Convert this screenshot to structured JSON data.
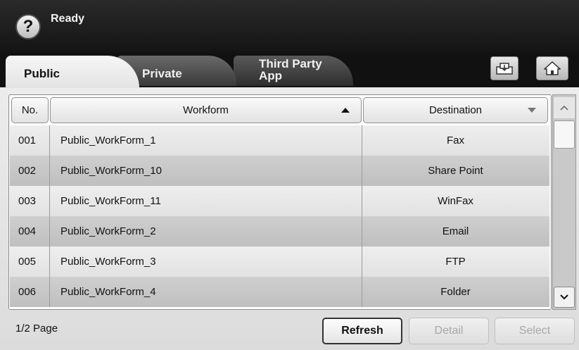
{
  "header": {
    "help_symbol": "?",
    "status": "Ready"
  },
  "tabs": [
    {
      "label": "Public",
      "active": true
    },
    {
      "label": "Private",
      "active": false
    },
    {
      "label": "Third Party App",
      "active": false
    }
  ],
  "toolbar": {
    "left_icon": "tray-icon",
    "right_icon": "home-icon"
  },
  "table": {
    "columns": [
      "No.",
      "Workform",
      "Destination"
    ],
    "rows": [
      {
        "no": "001",
        "workform": "Public_WorkForm_1",
        "destination": "Fax"
      },
      {
        "no": "002",
        "workform": "Public_WorkForm_10",
        "destination": "Share Point"
      },
      {
        "no": "003",
        "workform": "Public_WorkForm_11",
        "destination": "WinFax"
      },
      {
        "no": "004",
        "workform": "Public_WorkForm_2",
        "destination": "Email"
      },
      {
        "no": "005",
        "workform": "Public_WorkForm_3",
        "destination": "FTP"
      },
      {
        "no": "006",
        "workform": "Public_WorkForm_4",
        "destination": "Folder"
      }
    ]
  },
  "footer": {
    "page_info": "1/2 Page",
    "refresh_label": "Refresh",
    "detail_label": "Detail",
    "select_label": "Select"
  },
  "colors": {
    "header_bg": "#1e1e1e",
    "row_odd": "#e8e8e8",
    "row_even": "#c7c7c7"
  }
}
